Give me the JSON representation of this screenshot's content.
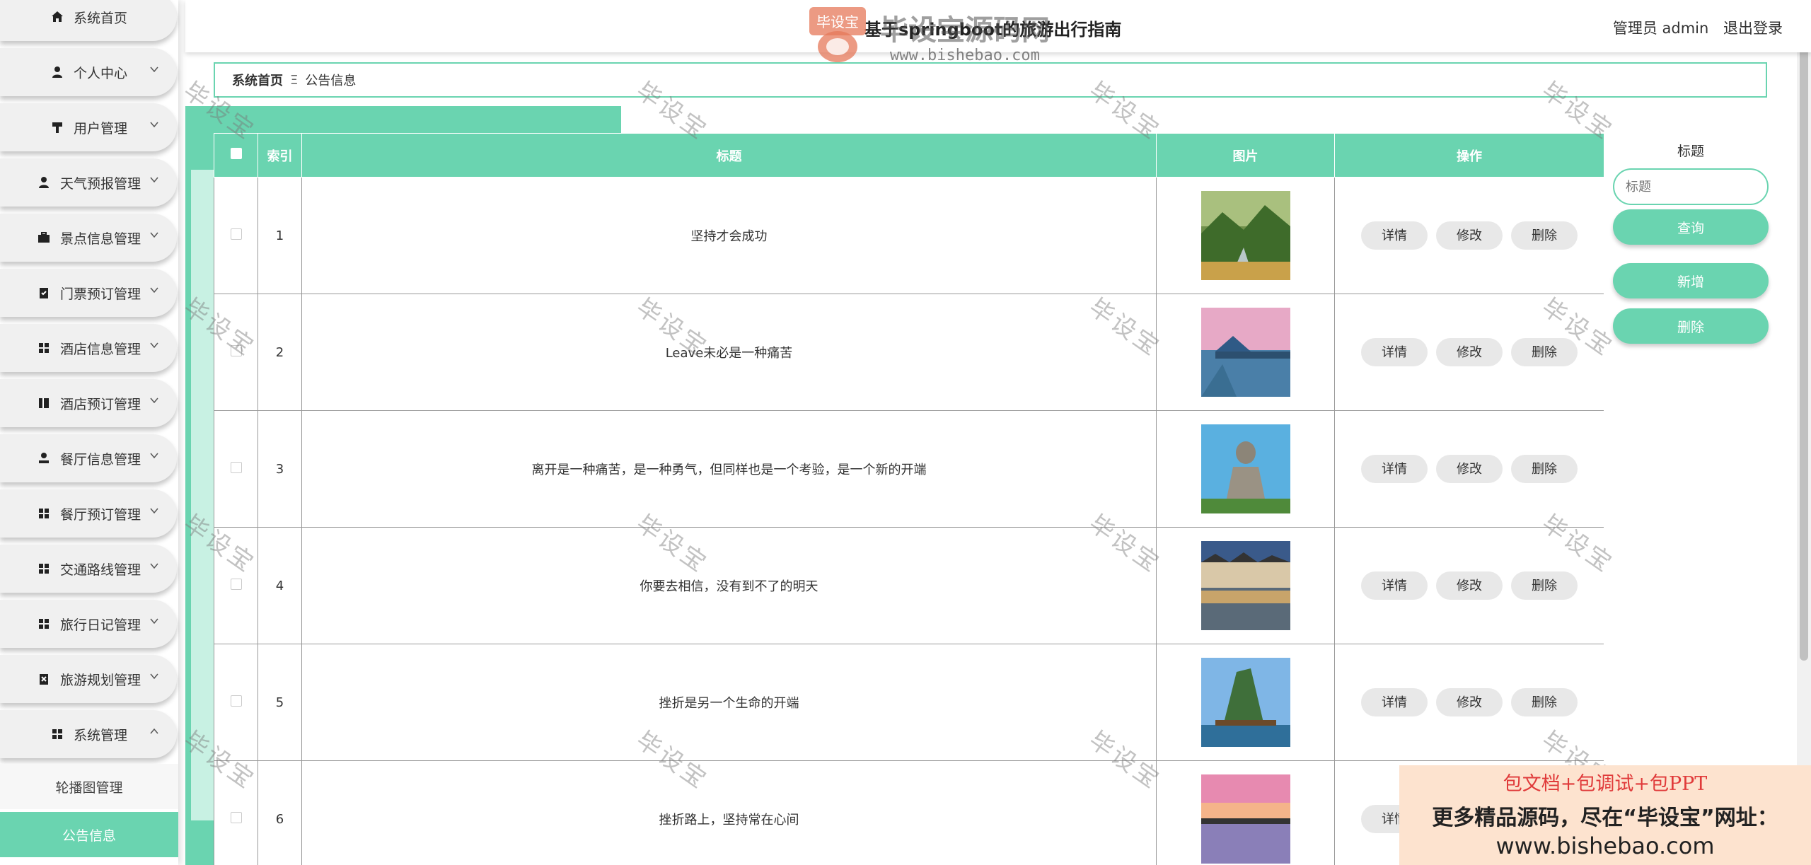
{
  "header": {
    "title": "基于springboot的旅游出行指南",
    "user_role": "管理员 admin",
    "logout_label": "退出登录"
  },
  "sidebar": {
    "items": [
      {
        "label": "系统首页",
        "icon": "home-icon",
        "chevron": false
      },
      {
        "label": "个人中心",
        "icon": "person-icon",
        "chevron": true
      },
      {
        "label": "用户管理",
        "icon": "users-icon",
        "chevron": true
      },
      {
        "label": "天气预报管理",
        "icon": "person-icon",
        "chevron": true
      },
      {
        "label": "景点信息管理",
        "icon": "briefcase-icon",
        "chevron": true
      },
      {
        "label": "门票预订管理",
        "icon": "clipboard-icon",
        "chevron": true
      },
      {
        "label": "酒店信息管理",
        "icon": "grid-icon",
        "chevron": true
      },
      {
        "label": "酒店预订管理",
        "icon": "book-icon",
        "chevron": true
      },
      {
        "label": "餐厅信息管理",
        "icon": "user-card-icon",
        "chevron": true
      },
      {
        "label": "餐厅预订管理",
        "icon": "grid-icon",
        "chevron": true
      },
      {
        "label": "交通路线管理",
        "icon": "grid-icon",
        "chevron": true
      },
      {
        "label": "旅行日记管理",
        "icon": "grid-icon",
        "chevron": true
      },
      {
        "label": "旅游规划管理",
        "icon": "clipboard-x-icon",
        "chevron": true
      },
      {
        "label": "系统管理",
        "icon": "grid-icon",
        "chevron": true
      }
    ],
    "submenu": [
      {
        "label": "轮播图管理",
        "active": false
      },
      {
        "label": "公告信息",
        "active": true
      }
    ]
  },
  "breadcrumb": {
    "home": "系统首页",
    "separator": "Ξ",
    "current": "公告信息"
  },
  "table": {
    "columns": [
      "索引",
      "标题",
      "图片",
      "操作"
    ],
    "actions": [
      "详情",
      "修改",
      "删除"
    ],
    "rows": [
      {
        "index": "1",
        "title": "坚持才会成功",
        "image": "forest-stream"
      },
      {
        "index": "2",
        "title": "Leave未必是一种痛苦",
        "image": "lake-pavilion"
      },
      {
        "index": "3",
        "title": "离开是一种痛苦，是一种勇气，但同样也是一个考验，是一个新的开端",
        "image": "buddha-statue"
      },
      {
        "index": "4",
        "title": "你要去相信，没有到不了的明天",
        "image": "water-village"
      },
      {
        "index": "5",
        "title": "挫折是另一个生命的开端",
        "image": "karst-mountain"
      },
      {
        "index": "6",
        "title": "挫折路上，坚持常在心间",
        "image": "sunset-lake"
      }
    ]
  },
  "search": {
    "label": "标题",
    "placeholder": "标题",
    "query_label": "查询",
    "add_label": "新增",
    "delete_label": "删除"
  },
  "watermark": {
    "text": "毕设宝",
    "logo_text": "毕设宝源码网",
    "logo_badge": "毕设宝",
    "logo_url": "www.bishebao.com"
  },
  "ad": {
    "line1": "包文档+包调试+包PPT",
    "line2": "更多精品源码，尽在“毕设宝”网址：",
    "line3": "www.bishebao.com"
  },
  "colors": {
    "accent": "#6ad4b0",
    "accent_light": "#c8f1e3",
    "button_gray": "#e8e8e8",
    "ad_bg": "#fde3cf",
    "ad_red": "#e03a3a"
  }
}
